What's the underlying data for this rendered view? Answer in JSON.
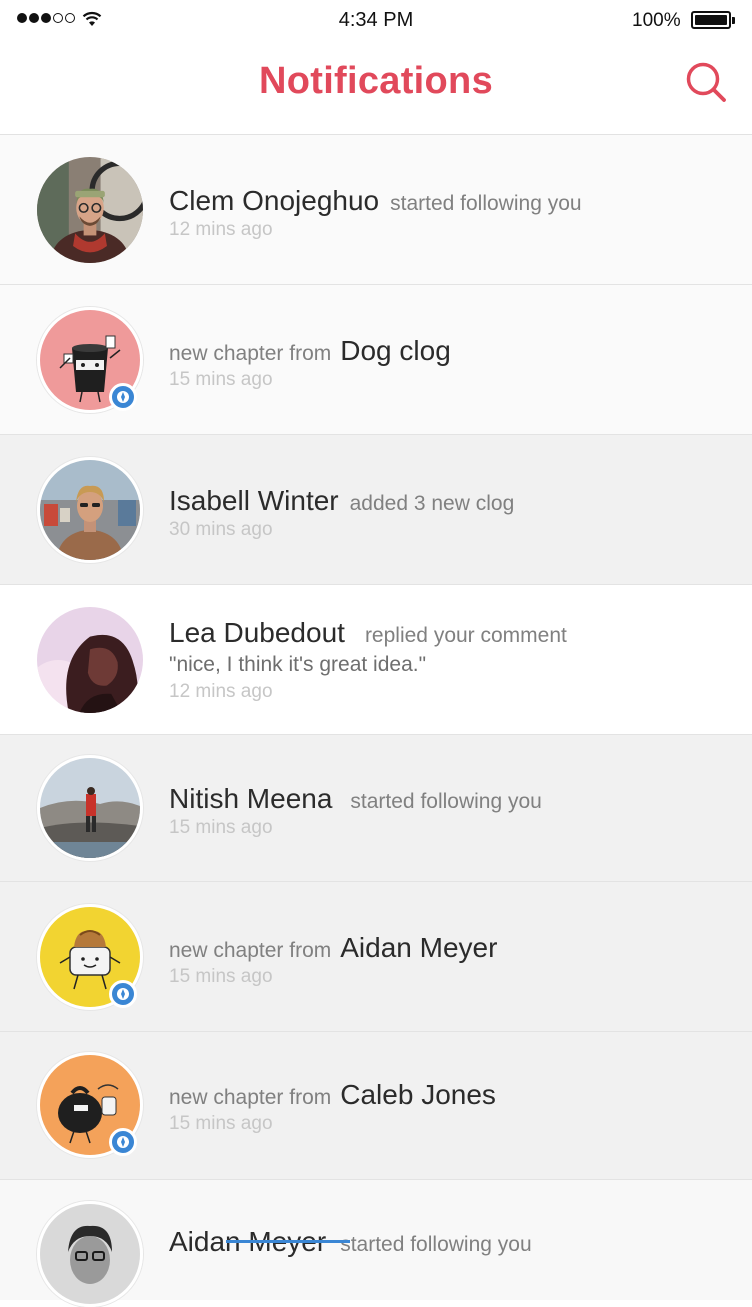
{
  "status_bar": {
    "time": "4:34 PM",
    "battery": "100%",
    "signal_bars_filled": 3,
    "signal_bars_total": 5
  },
  "header": {
    "title": "Notifications",
    "search_icon": "search-icon",
    "accent_color": "#e1495b"
  },
  "notifications": [
    {
      "name": "Clem Onojeghuo",
      "action": "started following you",
      "time": "12 mins ago"
    },
    {
      "prefix": "new chapter from",
      "name": "Dog clog",
      "time": "15 mins ago",
      "badge_icon": "compass-icon"
    },
    {
      "name": "Isabell Winter",
      "action": "added 3 new clog",
      "time": "30 mins ago"
    },
    {
      "name": "Lea Dubedout",
      "action": "replied your comment",
      "quote": "\"nice, I think it's great idea.\"",
      "time": "12 mins ago"
    },
    {
      "name": "Nitish Meena",
      "action": "started following you",
      "time": "15 mins ago"
    },
    {
      "prefix": "new chapter from",
      "name": "Aidan Meyer",
      "time": "15 mins ago",
      "badge_icon": "compass-icon"
    },
    {
      "prefix": "new chapter from",
      "name": "Caleb Jones",
      "time": "15 mins ago",
      "badge_icon": "compass-icon"
    },
    {
      "name": "Aidan Meyer",
      "action": "started following you"
    }
  ],
  "colors": {
    "badge": "#3a86d4",
    "muted_text": "#808080",
    "time_text": "#c6c6c6"
  }
}
